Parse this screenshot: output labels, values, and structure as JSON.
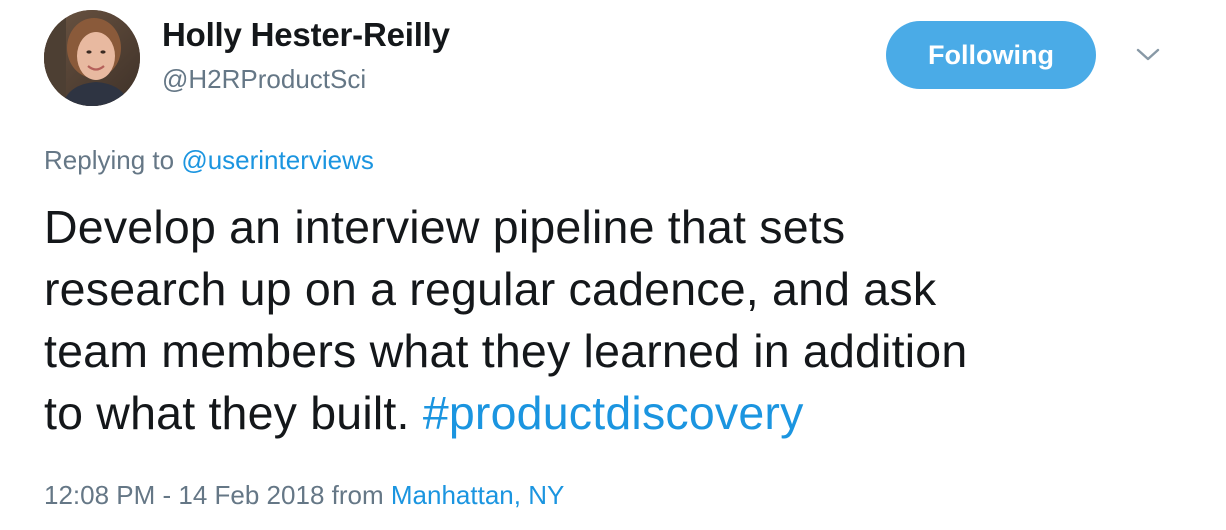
{
  "author": {
    "display_name": "Holly Hester-Reilly",
    "handle": "@H2RProductSci",
    "avatar_icon": "profile-photo"
  },
  "follow_button": {
    "label": "Following",
    "color": "#4aabe7"
  },
  "menu_icon": "chevron-down-icon",
  "reply": {
    "prefix": "Replying to",
    "mention": "@userinterviews"
  },
  "tweet": {
    "lines": [
      "Develop an interview pipeline that sets",
      "research up on a regular cadence, and ask",
      "team members what they learned in addition",
      "to what they built."
    ],
    "hashtag": "#productdiscovery"
  },
  "meta": {
    "timestamp": "12:08 PM - 14 Feb 2018",
    "from_label": "from",
    "location": "Manhattan, NY"
  },
  "colors": {
    "link": "#1b95e0",
    "secondary_text": "#657786",
    "primary_text": "#14171a"
  }
}
